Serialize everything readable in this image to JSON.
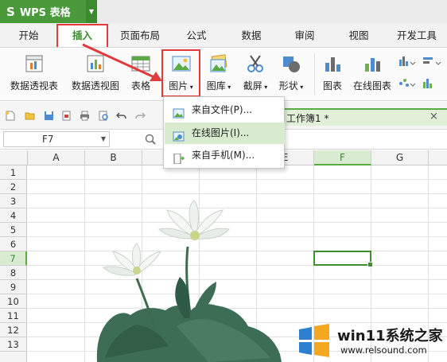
{
  "app": {
    "title": "WPS 表格",
    "logo": "S"
  },
  "menu": {
    "tabs": [
      {
        "label": "开始"
      },
      {
        "label": "插入"
      },
      {
        "label": "页面布局"
      },
      {
        "label": "公式"
      },
      {
        "label": "数据"
      },
      {
        "label": "审阅"
      },
      {
        "label": "视图"
      },
      {
        "label": "开发工具"
      }
    ],
    "active": "插入"
  },
  "ribbon": {
    "pivot_table": "数据透视表",
    "pivot_chart": "数据透视图",
    "table": "表格",
    "picture": "图片",
    "gallery": "图库",
    "screenshot": "截屏",
    "shapes": "形状",
    "chart": "图表",
    "online_chart": "在线图表"
  },
  "document": {
    "tab_title": "工作簿1 *",
    "close": "×"
  },
  "formula_bar": {
    "cell_ref": "F7"
  },
  "grid": {
    "columns": [
      "A",
      "B",
      "C",
      "D",
      "E",
      "F",
      "G"
    ],
    "selected_column": "F",
    "rows": [
      "1",
      "2",
      "3",
      "4",
      "5",
      "6",
      "7",
      "8",
      "9",
      "10",
      "11",
      "12",
      "13"
    ],
    "selected_row": "7"
  },
  "dropdown": {
    "items": [
      {
        "label": "来自文件(P)..."
      },
      {
        "label": "在线图片(I)..."
      },
      {
        "label": "来自手机(M)..."
      }
    ],
    "hovered_index": 1
  },
  "watermark": {
    "brand": "win11系统之家",
    "url": "www.relsound.com"
  },
  "colors": {
    "accent": "#4a9a3c",
    "highlight": "#e23b3b",
    "selection": "#3f8f30"
  }
}
